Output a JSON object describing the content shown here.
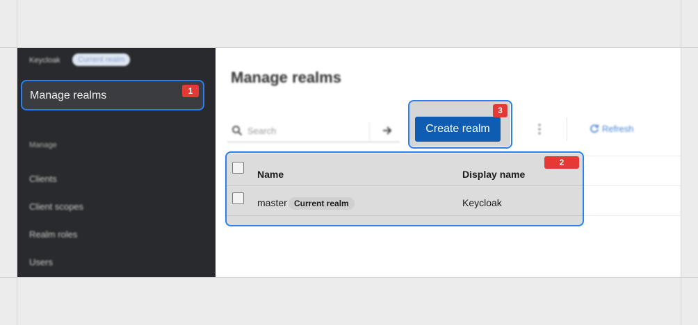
{
  "sidebar": {
    "brand": "Keycloak",
    "brand_badge": "Current realm",
    "manage_realms": "Manage realms",
    "section_manage": "Manage",
    "links": [
      "Clients",
      "Client scopes",
      "Realm roles",
      "Users"
    ]
  },
  "main": {
    "title": "Manage realms",
    "search_placeholder": "Search",
    "create_button": "Create realm",
    "refresh_label": "Refresh"
  },
  "table": {
    "headers": {
      "name": "Name",
      "display_name": "Display name"
    },
    "rows": [
      {
        "name": "master",
        "badge": "Current realm",
        "display_name": "Keycloak"
      }
    ]
  },
  "annotations": {
    "badge_1": "1",
    "badge_2": "2",
    "badge_3": "3"
  },
  "colors": {
    "primary": "#0f5db3",
    "highlight": "#2b7ff3",
    "badge": "#e53935",
    "sidebar": "#292a2d"
  }
}
